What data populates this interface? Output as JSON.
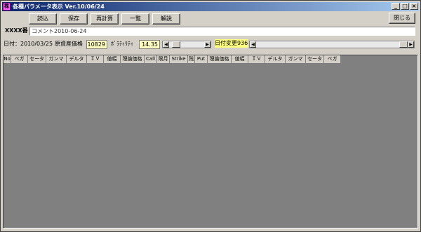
{
  "window": {
    "title": "各種パラメータ表示 Ver.10/06/24",
    "minimize": "_",
    "maximize": "□",
    "close": "×"
  },
  "toolbar": {
    "load": "読込",
    "save": "保存",
    "recalc": "再計算",
    "list": "一覧",
    "explain": "解説",
    "close": "閉じる"
  },
  "info": {
    "code_label": "XXXX番",
    "comment": "コメント2010-06-24",
    "date_label": "日付：2010/03/25",
    "underlying_label": "原資産価格",
    "underlying_value": "10829",
    "volatility_label": "ﾎﾞﾗﾃｨﾘﾃｨ",
    "volatility_value": "14.35",
    "date_change_label": "日付変更936"
  },
  "grid": {
    "columns": [
      "No",
      "ベガ",
      "セータ",
      "ガンマ",
      "デルタ",
      "ＩＶ",
      "値幅",
      "理論価格",
      "Call",
      "限月",
      "Strike",
      "残",
      "Put",
      "理論価格",
      "値幅",
      "ＩＶ",
      "デルタ",
      "ガンマ",
      "セータ",
      "ベガ"
    ],
    "colors": {
      "background": "#808080",
      "header": "#d4d0c8"
    }
  }
}
